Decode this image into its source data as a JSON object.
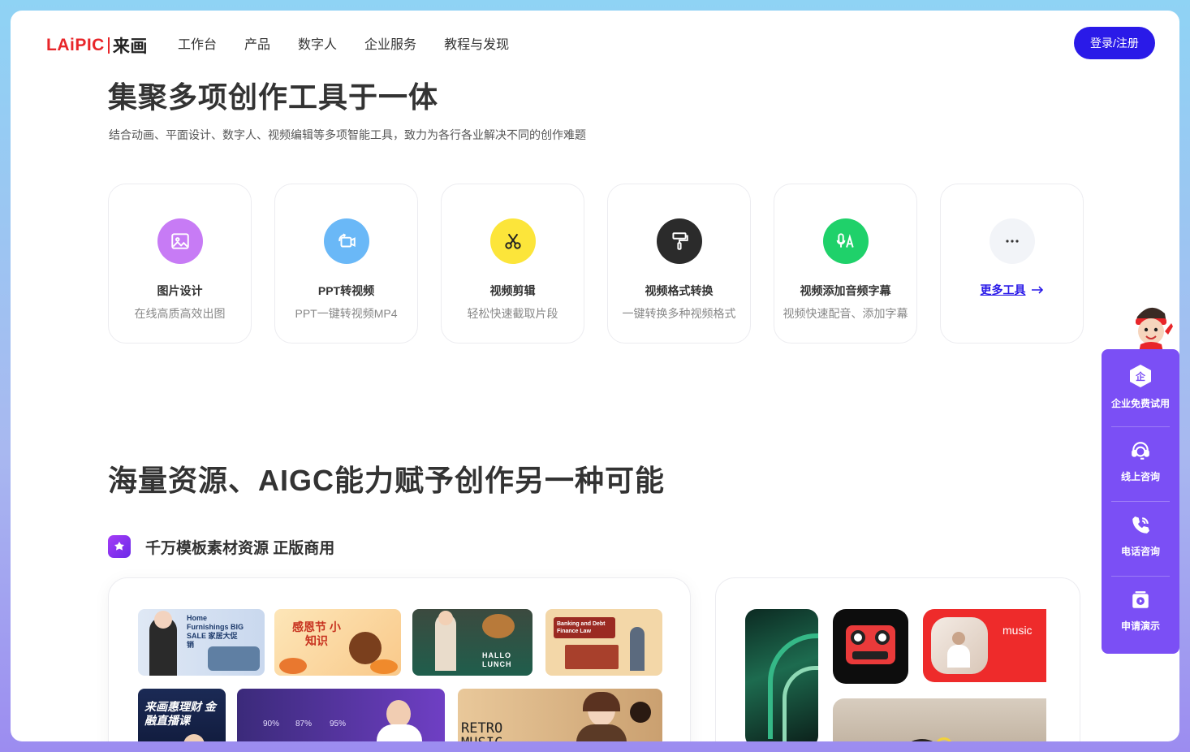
{
  "nav": {
    "logo_en": "LAiPIC",
    "logo_cn": "来画",
    "menu": [
      "工作台",
      "产品",
      "数字人",
      "企业服务",
      "教程与发现"
    ],
    "login": "登录/注册"
  },
  "hero": {
    "title": "集聚多项创作工具于一体",
    "subtitle": "结合动画、平面设计、数字人、视频编辑等多项智能工具，致力为各行各业解决不同的创作难题"
  },
  "tools": [
    {
      "title": "图片设计",
      "desc": "在线高质高效出图",
      "icon": "image-icon",
      "color": "#c77bf5"
    },
    {
      "title": "PPT转视频",
      "desc": "PPT一键转视频MP4",
      "icon": "video-convert-icon",
      "color": "#6ab8f7"
    },
    {
      "title": "视频剪辑",
      "desc": "轻松快速截取片段",
      "icon": "scissors-icon",
      "color": "#fce53a"
    },
    {
      "title": "视频格式转换",
      "desc": "一键转换多种视频格式",
      "icon": "paint-roller-icon",
      "color": "#2b2b2b"
    },
    {
      "title": "视频添加音频字幕",
      "desc": "视频快速配音、添加字幕",
      "icon": "audio-subtitle-icon",
      "color": "#1fd16a"
    },
    {
      "more": "更多工具",
      "icon": "more-icon",
      "color": "#f2f4f8"
    }
  ],
  "section2": {
    "title": "海量资源、AIGC能力赋予创作另一种可能",
    "resource_title": "千万模板素材资源 正版商用"
  },
  "thumbs": {
    "t1": "Home Furnishings BIG SALE 家居大促销",
    "t2": "感恩节 小知识",
    "t3": "HALLO LUNCH",
    "t4": "Banking and Debt Finance Law",
    "t5": "来画惠理财 金融直播课",
    "t6_a": "90%",
    "t6_b": "87%",
    "t6_c": "95%",
    "t7": "RETRO MUSIC",
    "music": "music"
  },
  "sidebar": [
    "企业免费试用",
    "线上咨询",
    "电话咨询",
    "申请演示"
  ]
}
